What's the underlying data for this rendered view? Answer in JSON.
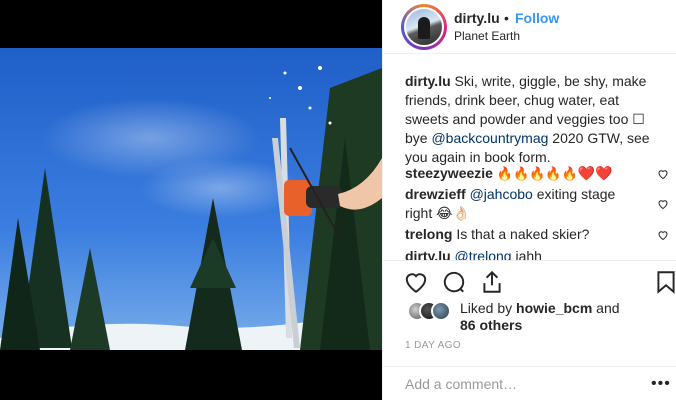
{
  "post": {
    "username": "dirty.lu",
    "separator": "•",
    "follow_label": "Follow",
    "location": "Planet Earth"
  },
  "caption": {
    "username": "dirty.lu",
    "text_part1": " Ski, write, giggle, be shy, make friends, drink beer, chug water, eat sweets and powder and veggies too ☐ bye ",
    "mention": "@backcountrymag",
    "text_part2": " 2020 GTW, see you again in book form."
  },
  "comments": [
    {
      "username": "steezyweezie",
      "emoji_fire": "🔥🔥🔥🔥🔥",
      "emoji_hearts": "❤️❤️"
    },
    {
      "username": "drewzieff",
      "mention": "@jahcobo",
      "text": " exiting stage right 😂👌🏻"
    },
    {
      "username": "trelong",
      "text": " Is that a naked skier?"
    },
    {
      "username": "dirty.lu",
      "mention": "@trelong",
      "text": " jahh"
    }
  ],
  "likes": {
    "text_prefix": "Liked by ",
    "user": "howie_bcm",
    "text_mid": " and",
    "others": "86 others"
  },
  "timestamp": "1 DAY AGO",
  "add_comment": {
    "placeholder": "Add a comment…",
    "more": "•••"
  },
  "colors": {
    "accent": "#3897f0",
    "link": "#003569",
    "muted": "#999999",
    "sky": "#2f6bd0"
  }
}
